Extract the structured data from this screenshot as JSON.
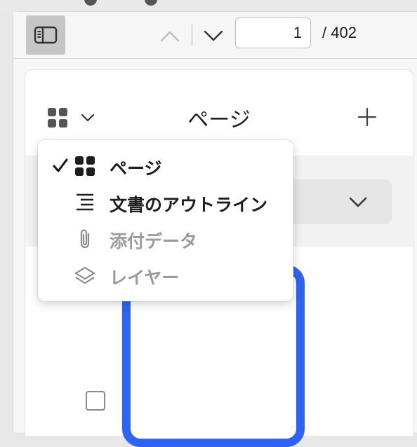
{
  "toolbar": {
    "current_page": "1",
    "total_pages": "/ 402",
    "icons": [
      "sidebar-toggle-icon",
      "chevron-up-icon",
      "chevron-down-icon"
    ]
  },
  "panel": {
    "title": "ページ",
    "view_menu": {
      "items": [
        {
          "label": "ページ",
          "icon": "grid-icon",
          "checked": true,
          "enabled": true
        },
        {
          "label": "文書のアウトライン",
          "icon": "list-icon",
          "checked": false,
          "enabled": true
        },
        {
          "label": "添付データ",
          "icon": "paperclip-icon",
          "checked": false,
          "enabled": false
        },
        {
          "label": "レイヤー",
          "icon": "layers-icon",
          "checked": false,
          "enabled": false
        }
      ]
    }
  },
  "colors": {
    "accent": "#2f63f2",
    "disabled_text": "#9a9a9a",
    "toolbar_button_bg": "#c6c6c6"
  }
}
